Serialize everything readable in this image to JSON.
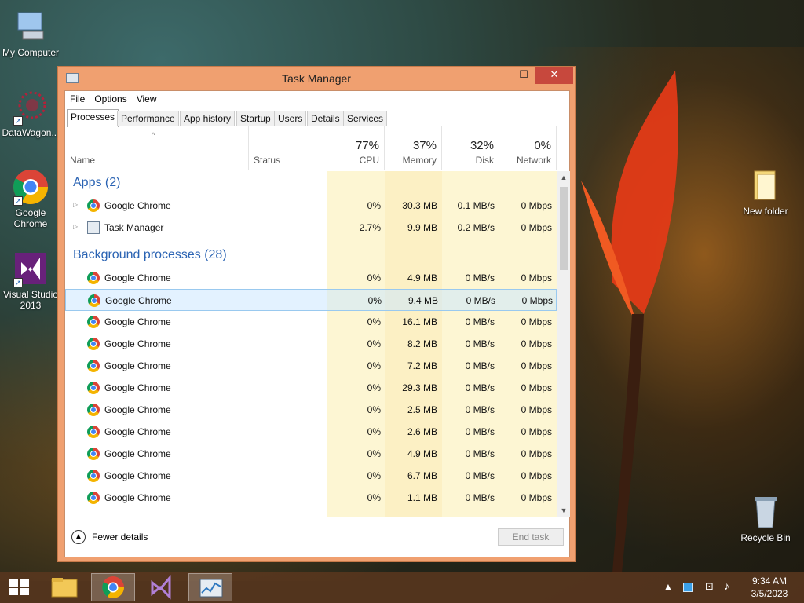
{
  "desktop": {
    "icons": {
      "my_computer": "My Computer",
      "datawagon": "DataWagon...",
      "chrome": "Google Chrome",
      "vs": "Visual Studio 2013",
      "new_folder": "New folder",
      "recycle": "Recycle Bin"
    }
  },
  "window": {
    "title": "Task Manager",
    "controls": {
      "minimize": "—",
      "maximize": "☐",
      "close": "✕"
    },
    "menu": [
      "File",
      "Options",
      "View"
    ],
    "tabs": [
      "Processes",
      "Performance",
      "App history",
      "Startup",
      "Users",
      "Details",
      "Services"
    ],
    "active_tab": "Processes",
    "header": {
      "name": "Name",
      "status": "Status",
      "cpu_pct": "77%",
      "cpu": "CPU",
      "mem_pct": "37%",
      "mem": "Memory",
      "disk_pct": "32%",
      "disk": "Disk",
      "net_pct": "0%",
      "net": "Network",
      "sort_arrow": "^"
    },
    "groups": {
      "apps": "Apps (2)",
      "background": "Background processes (28)"
    },
    "apps": [
      {
        "name": "Google Chrome",
        "icon": "chrome-icon",
        "cpu": "0%",
        "mem": "30.3 MB",
        "disk": "0.1 MB/s",
        "net": "0 Mbps"
      },
      {
        "name": "Task Manager",
        "icon": "task-manager-icon",
        "cpu": "2.7%",
        "mem": "9.9 MB",
        "disk": "0.2 MB/s",
        "net": "0 Mbps"
      }
    ],
    "background": [
      {
        "name": "Google Chrome",
        "cpu": "0%",
        "mem": "4.9 MB",
        "disk": "0 MB/s",
        "net": "0 Mbps"
      },
      {
        "name": "Google Chrome",
        "cpu": "0%",
        "mem": "9.4 MB",
        "disk": "0 MB/s",
        "net": "0 Mbps"
      },
      {
        "name": "Google Chrome",
        "cpu": "0%",
        "mem": "16.1 MB",
        "disk": "0 MB/s",
        "net": "0 Mbps"
      },
      {
        "name": "Google Chrome",
        "cpu": "0%",
        "mem": "8.2 MB",
        "disk": "0 MB/s",
        "net": "0 Mbps"
      },
      {
        "name": "Google Chrome",
        "cpu": "0%",
        "mem": "7.2 MB",
        "disk": "0 MB/s",
        "net": "0 Mbps"
      },
      {
        "name": "Google Chrome",
        "cpu": "0%",
        "mem": "29.3 MB",
        "disk": "0 MB/s",
        "net": "0 Mbps"
      },
      {
        "name": "Google Chrome",
        "cpu": "0%",
        "mem": "2.5 MB",
        "disk": "0 MB/s",
        "net": "0 Mbps"
      },
      {
        "name": "Google Chrome",
        "cpu": "0%",
        "mem": "2.6 MB",
        "disk": "0 MB/s",
        "net": "0 Mbps"
      },
      {
        "name": "Google Chrome",
        "cpu": "0%",
        "mem": "4.9 MB",
        "disk": "0 MB/s",
        "net": "0 Mbps"
      },
      {
        "name": "Google Chrome",
        "cpu": "0%",
        "mem": "6.7 MB",
        "disk": "0 MB/s",
        "net": "0 Mbps"
      },
      {
        "name": "Google Chrome",
        "cpu": "0%",
        "mem": "1.1 MB",
        "disk": "0 MB/s",
        "net": "0 Mbps"
      }
    ],
    "selected_background_index": 1,
    "footer": {
      "fewer": "Fewer details",
      "end_task": "End task"
    }
  },
  "taskbar": {
    "time": "9:34 AM",
    "date": "3/5/2023"
  }
}
